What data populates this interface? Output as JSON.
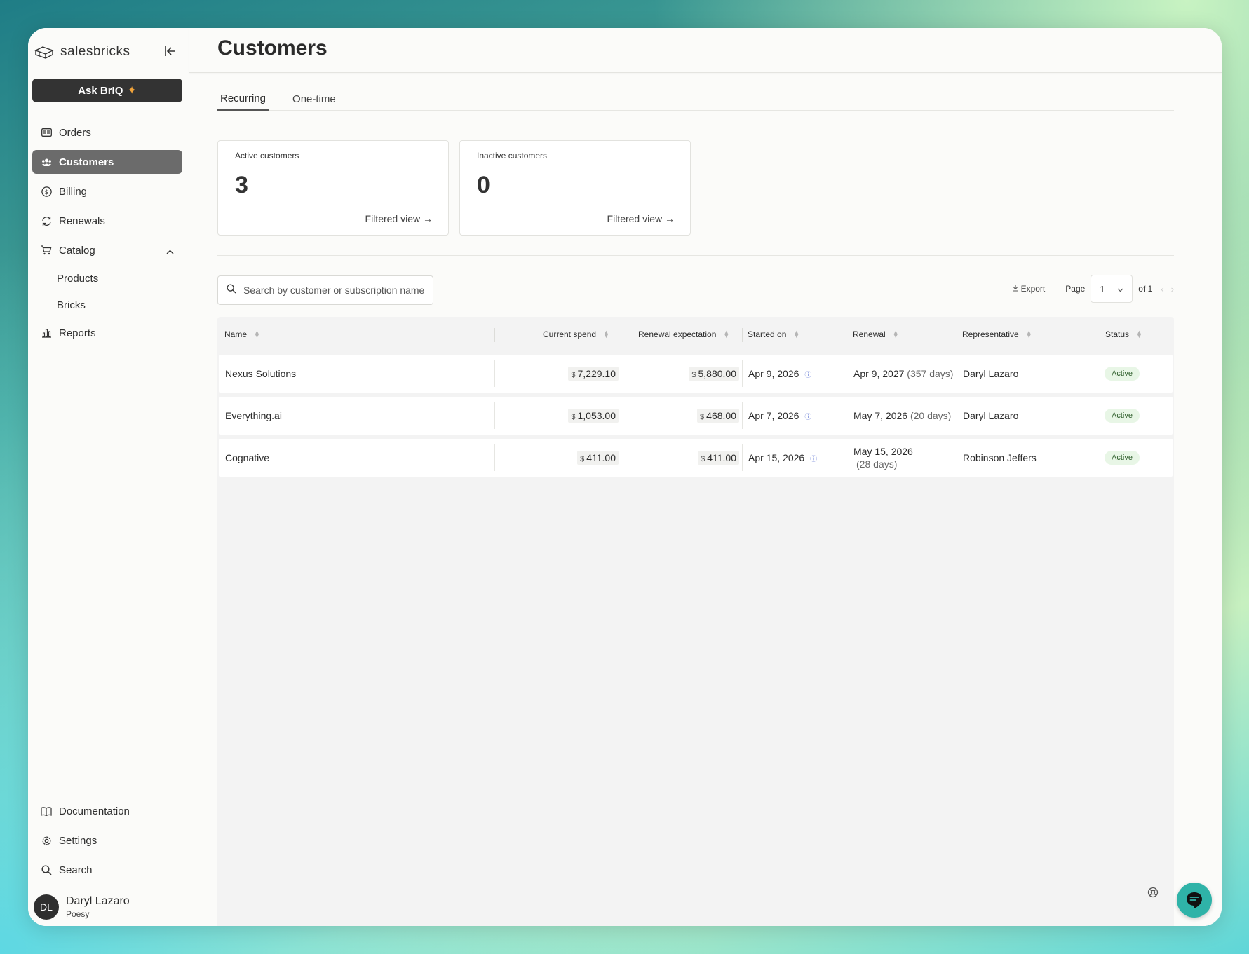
{
  "sidebar": {
    "brand": "salesbricks",
    "ask_button": "Ask BrIQ",
    "items": [
      {
        "label": "Orders"
      },
      {
        "label": "Customers"
      },
      {
        "label": "Billing"
      },
      {
        "label": "Renewals"
      },
      {
        "label": "Catalog"
      }
    ],
    "catalog_sub": [
      {
        "label": "Products"
      },
      {
        "label": "Bricks"
      }
    ],
    "reports": "Reports",
    "bottom": [
      {
        "label": "Documentation"
      },
      {
        "label": "Settings"
      },
      {
        "label": "Search"
      }
    ],
    "user": {
      "initials": "DL",
      "name": "Daryl Lazaro",
      "org": "Poesy"
    }
  },
  "header": {
    "title": "Customers"
  },
  "tabs": [
    {
      "label": "Recurring",
      "active": true
    },
    {
      "label": "One-time",
      "active": false
    }
  ],
  "stats": [
    {
      "label": "Active customers",
      "value": "3",
      "link": "Filtered view →"
    },
    {
      "label": "Inactive customers",
      "value": "0",
      "link": "Filtered view →"
    }
  ],
  "search": {
    "placeholder": "Search by customer or subscription name"
  },
  "toolbar": {
    "export": "Export",
    "page_label": "Page",
    "page_value": "1",
    "page_of": "of 1"
  },
  "table": {
    "headers": {
      "name": "Name",
      "current_spend": "Current spend",
      "renewal_expectation": "Renewal expectation",
      "started_on": "Started on",
      "renewal": "Renewal",
      "representative": "Representative",
      "status": "Status"
    },
    "currency_symbol": "$",
    "rows": [
      {
        "name": "Nexus Solutions",
        "current_spend": "7,229.10",
        "renewal_expectation": "5,880.00",
        "started_on": "Apr 9, 2026",
        "renewal_date": "Apr 9, 2027",
        "renewal_days": "(357 days)",
        "representative": "Daryl Lazaro",
        "status": "Active"
      },
      {
        "name": "Everything.ai",
        "current_spend": "1,053.00",
        "renewal_expectation": "468.00",
        "started_on": "Apr 7, 2026",
        "renewal_date": "May 7, 2026",
        "renewal_days": "(20 days)",
        "representative": "Daryl Lazaro",
        "status": "Active"
      },
      {
        "name": "Cognative",
        "current_spend": "411.00",
        "renewal_expectation": "411.00",
        "started_on": "Apr 15, 2026",
        "renewal_date": "May 15, 2026",
        "renewal_days": "(28 days)",
        "representative": "Robinson Jeffers",
        "status": "Active"
      }
    ]
  },
  "colors": {
    "active_nav": "#6b6b6b",
    "status_bg": "#e8f6e6",
    "chat": "#2fb3a8",
    "spark": "#f0a33a"
  }
}
